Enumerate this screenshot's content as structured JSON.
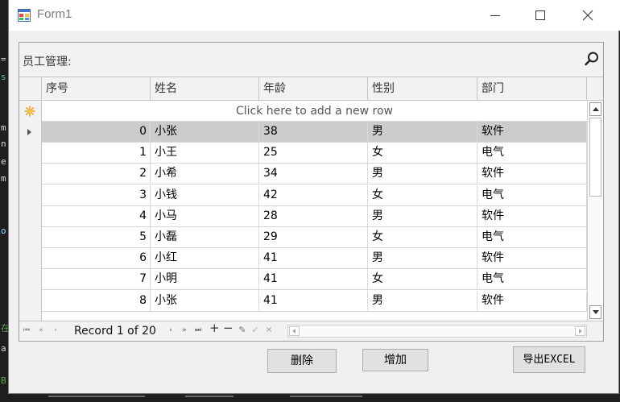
{
  "window": {
    "title": "Form1"
  },
  "panel": {
    "title": "员工管理:"
  },
  "grid": {
    "columns": [
      "序号",
      "姓名",
      "年龄",
      "性别",
      "部门"
    ],
    "new_row_text": "Click here to add a new row",
    "rows": [
      [
        "0",
        "小张",
        "38",
        "男",
        "软件"
      ],
      [
        "1",
        "小王",
        "25",
        "女",
        "电气"
      ],
      [
        "2",
        "小希",
        "34",
        "男",
        "软件"
      ],
      [
        "3",
        "小钱",
        "42",
        "女",
        "电气"
      ],
      [
        "4",
        "小马",
        "28",
        "男",
        "软件"
      ],
      [
        "5",
        "小磊",
        "29",
        "女",
        "电气"
      ],
      [
        "6",
        "小红",
        "41",
        "男",
        "软件"
      ],
      [
        "7",
        "小明",
        "41",
        "女",
        "电气"
      ],
      [
        "8",
        "小张",
        "41",
        "男",
        "软件"
      ]
    ],
    "selected_row": 0
  },
  "navigator": {
    "record_text": "Record 1 of 20"
  },
  "buttons": {
    "delete": "删除",
    "add": "增加",
    "export": "导出EXCEL"
  },
  "background": {
    "left_glyphs": [
      "=",
      "s",
      "m",
      "n",
      "e",
      "m",
      "o",
      "在",
      "a",
      "B"
    ]
  }
}
